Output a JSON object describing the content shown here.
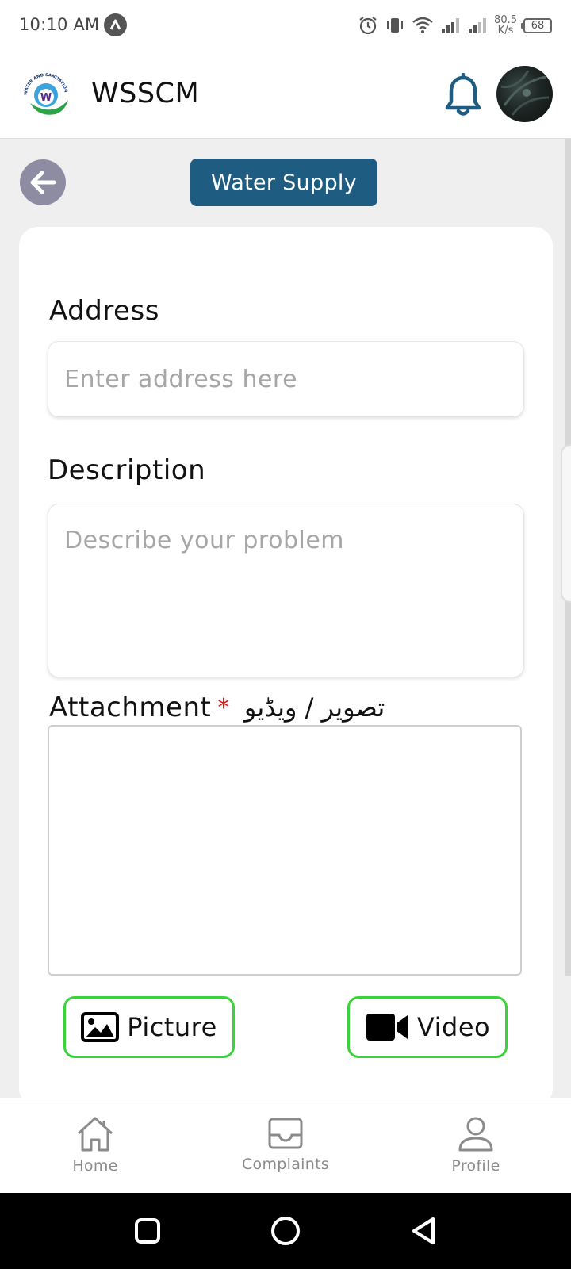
{
  "status_bar": {
    "time": "10:10 AM",
    "speed_value": "80.5",
    "speed_unit": "K/s",
    "battery": "68"
  },
  "header": {
    "app_title": "WSSCM",
    "logo_text": "WATER AND SANITATION SERVICES COMPANY MANSEHRA",
    "logo_letter": "W"
  },
  "page": {
    "title": "Water Supply"
  },
  "form": {
    "address_label": "Address",
    "address_placeholder": "Enter address here",
    "address_value": "",
    "description_label": "Description",
    "description_placeholder": "Describe your problem",
    "description_value": "",
    "attachment_label": "Attachment",
    "required_mark": "*",
    "attachment_urdu": "تصویر / ویڈیو",
    "picture_button": "Picture",
    "video_button": "Video"
  },
  "bottom_nav": {
    "items": [
      {
        "label": "Home",
        "icon": "home-icon"
      },
      {
        "label": "Complaints",
        "icon": "inbox-icon"
      },
      {
        "label": "Profile",
        "icon": "user-icon"
      }
    ]
  },
  "colors": {
    "title_pill": "#1f5c81",
    "bell": "#1f5c81",
    "back_button": "#8e8ca3",
    "media_border": "#3cd23c",
    "required": "#e21010"
  }
}
